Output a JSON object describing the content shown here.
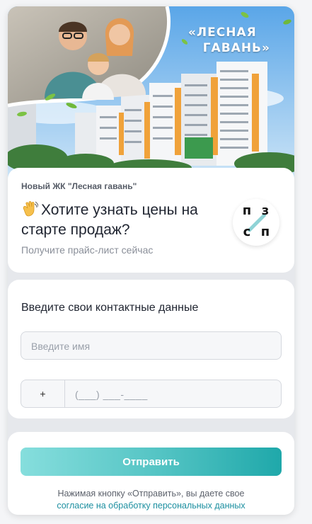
{
  "hero": {
    "brand_line1": "«ЛЕСНАЯ",
    "brand_line2": "ГАВАНЬ»"
  },
  "offer": {
    "project_name": "Новый ЖК \"Лесная гавань\"",
    "headline": "Хотите узнать цены на старте продаж?",
    "subline": "Получите прайс-лист сейчас",
    "logo_letters": [
      "п",
      "з",
      "с",
      "п"
    ]
  },
  "form": {
    "title": "Введите свои контактные данные",
    "name_placeholder": "Введите имя",
    "phone_prefix": "+",
    "phone_mask": "(___) ___-____"
  },
  "submit": {
    "label": "Отправить",
    "consent_text": "Нажимая кнопку «Отправить», вы даете свое",
    "consent_link": "согласие на обработку персональных данных"
  },
  "colors": {
    "accent": "#3cb8ba",
    "link": "#1c8fa0",
    "headline": "#1f2430"
  },
  "icons": {
    "headline_emoji": "waving-hand-icon"
  }
}
